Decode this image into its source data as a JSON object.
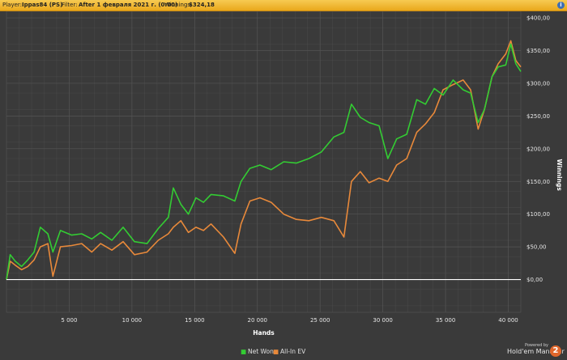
{
  "header": {
    "player_label": "Player:",
    "player_value": "Ippas84 (PS)",
    "filter_label": "Filter:",
    "filter_value": "After 1 февраля 2021 г. (0:00)",
    "winnings_label": "Winnings:",
    "winnings_value": "$324,18",
    "info_icon": "info-icon",
    "info_text": "i"
  },
  "colors": {
    "background": "#3a3a3a",
    "grid": "#555555",
    "header": "#f0b83a",
    "net_won": "#33cc33",
    "all_in_ev": "#e8893a",
    "zero_line": "#ffffff"
  },
  "chart_data": {
    "type": "line",
    "xlabel": "Hands",
    "ylabel": "Winnings",
    "xlim": [
      0,
      41000
    ],
    "ylim": [
      -50,
      410
    ],
    "x_ticks": [
      5000,
      10000,
      15000,
      20000,
      25000,
      30000,
      35000,
      40000
    ],
    "x_tick_labels": [
      "5 000",
      "10 000",
      "15 000",
      "20 000",
      "25 000",
      "30 000",
      "35 000",
      "40 000"
    ],
    "y_ticks": [
      0,
      50,
      100,
      150,
      200,
      250,
      300,
      350,
      400
    ],
    "y_tick_labels": [
      "$0,00",
      "$50,00",
      "$100,00",
      "$150,00",
      "$200,00",
      "$250,00",
      "$300,00",
      "$350,00",
      "$400,00"
    ],
    "zero_line": true,
    "grid": true,
    "legend": "bottom-center",
    "series": [
      {
        "name": "Net Won",
        "x": [
          0,
          300,
          700,
          1200,
          1700,
          2200,
          2700,
          3300,
          3700,
          4300,
          5200,
          6000,
          6800,
          7500,
          8400,
          9300,
          10200,
          11200,
          12100,
          12900,
          13300,
          13900,
          14500,
          15100,
          15700,
          16300,
          17300,
          18200,
          18700,
          19400,
          20200,
          21100,
          22100,
          23100,
          24100,
          25100,
          26100,
          26900,
          27500,
          28200,
          28900,
          29700,
          30400,
          31100,
          31900,
          32700,
          33400,
          34100,
          34800,
          35600,
          36400,
          37000,
          37600,
          38100,
          38700,
          39200,
          39800,
          40200,
          40600,
          41000
        ],
        "y": [
          0,
          38,
          28,
          20,
          30,
          42,
          80,
          70,
          42,
          75,
          68,
          70,
          62,
          72,
          60,
          80,
          58,
          55,
          78,
          95,
          140,
          115,
          100,
          125,
          118,
          130,
          128,
          120,
          150,
          170,
          175,
          168,
          180,
          178,
          185,
          195,
          218,
          225,
          268,
          248,
          240,
          235,
          185,
          215,
          222,
          275,
          268,
          292,
          282,
          305,
          290,
          285,
          240,
          260,
          310,
          325,
          328,
          360,
          330,
          318
        ]
      },
      {
        "name": "All-In EV",
        "x": [
          0,
          300,
          700,
          1200,
          1700,
          2200,
          2700,
          3300,
          3700,
          4300,
          5200,
          6000,
          6800,
          7500,
          8400,
          9300,
          10200,
          11200,
          12100,
          12900,
          13300,
          13900,
          14500,
          15100,
          15700,
          16300,
          17300,
          18200,
          18700,
          19400,
          20200,
          21100,
          22100,
          23100,
          24100,
          25100,
          26100,
          26900,
          27500,
          28200,
          28900,
          29700,
          30400,
          31100,
          31900,
          32700,
          33400,
          34100,
          34800,
          35600,
          36400,
          37000,
          37600,
          38100,
          38700,
          39200,
          39800,
          40200,
          40600,
          41000
        ],
        "y": [
          0,
          28,
          22,
          15,
          20,
          30,
          50,
          55,
          5,
          50,
          52,
          55,
          42,
          55,
          45,
          58,
          38,
          42,
          60,
          70,
          80,
          90,
          72,
          80,
          75,
          85,
          65,
          40,
          85,
          120,
          125,
          118,
          100,
          92,
          90,
          95,
          90,
          65,
          150,
          165,
          148,
          155,
          150,
          175,
          185,
          225,
          238,
          255,
          290,
          298,
          305,
          290,
          230,
          260,
          310,
          330,
          345,
          365,
          335,
          325
        ]
      }
    ]
  },
  "legend_items": [
    {
      "label": "Net Won"
    },
    {
      "label": "All-In EV"
    }
  ],
  "branding": {
    "powered_by": "Powered by",
    "product": "Hold'em Manager",
    "badge": "2"
  }
}
